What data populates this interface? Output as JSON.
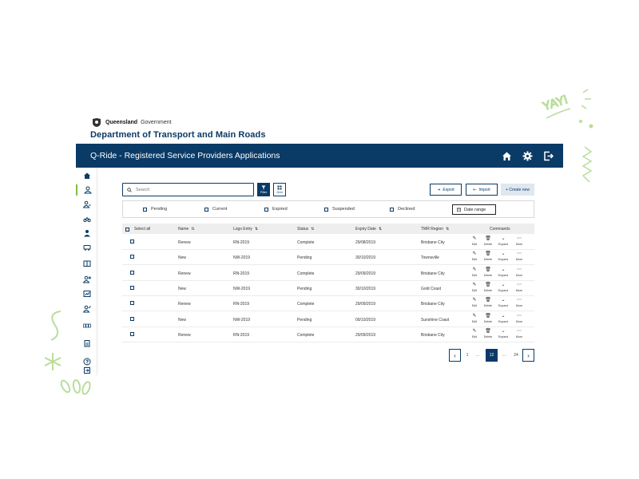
{
  "gov": {
    "brand_bold": "Queensland",
    "brand_rest": " Government",
    "department": "Department of Transport and Main Roads"
  },
  "appbar": {
    "title": "Q-Ride - Registered Service Providers  Applications"
  },
  "doodle": {
    "yay": "YAY!"
  },
  "toolbar": {
    "search_placeholder": "Search",
    "filter_label": "Filter",
    "grid_label": "Grid",
    "export_label": "Export",
    "import_label": "Import",
    "create_label": "+ Create new"
  },
  "filters": {
    "items": [
      "Pending",
      "Current",
      "Expired",
      "Suspended",
      "Declined"
    ],
    "date_range": "Date range"
  },
  "table": {
    "columns": {
      "select_all": "Select all",
      "name": "Name",
      "logs": "Logs Entry",
      "status": "Status",
      "expiry": "Expiry Date",
      "region": "TMR Region",
      "commands": "Commands"
    },
    "commands": [
      "Edit",
      "Delete",
      "Expand",
      "More"
    ],
    "rows": [
      {
        "name": "Renew",
        "logs": "RN-2019",
        "status": "Complete",
        "expiry": "29/08/2019",
        "region": "Brisbane City"
      },
      {
        "name": "New",
        "logs": "NW-2019",
        "status": "Pending",
        "expiry": "30/10/2019",
        "region": "Townsville"
      },
      {
        "name": "Renew",
        "logs": "RN-2019",
        "status": "Complete",
        "expiry": "29/09/2019",
        "region": "Brisbane City"
      },
      {
        "name": "New",
        "logs": "NW-2019",
        "status": "Pending",
        "expiry": "30/10/2019",
        "region": "Gold Coast"
      },
      {
        "name": "Renew",
        "logs": "RN-2019",
        "status": "Complete",
        "expiry": "29/09/2019",
        "region": "Brisbane City"
      },
      {
        "name": "New",
        "logs": "NW-2019",
        "status": "Pending",
        "expiry": "09/10/2019",
        "region": "Sunshine Coast"
      },
      {
        "name": "Renew",
        "logs": "RN-2019",
        "status": "Complete",
        "expiry": "29/09/2019",
        "region": "Brisbane City"
      }
    ]
  },
  "pagination": {
    "prev": "‹",
    "first": "1",
    "gap1": "...",
    "current": "12",
    "gap2": "...",
    "last": "24",
    "next": "›"
  },
  "colors": {
    "primary": "#0a3a66",
    "accent": "#7dc242",
    "doodle": "#b9dd9a"
  }
}
